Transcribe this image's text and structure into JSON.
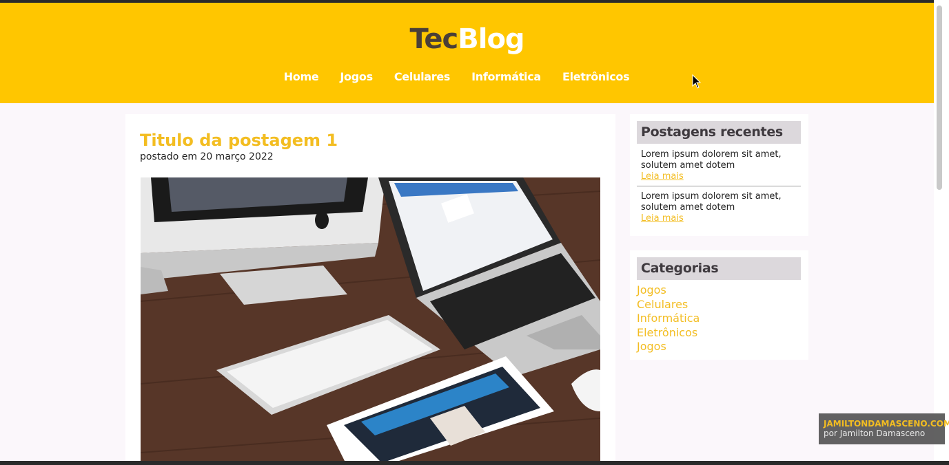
{
  "header": {
    "logo_part1": "Tec",
    "logo_part2": "Blog",
    "nav": [
      "Home",
      "Jogos",
      "Celulares",
      "Informática",
      "Eletrônicos"
    ]
  },
  "post": {
    "title": "Titulo da postagem 1",
    "date": "postado em 20 março 2022"
  },
  "sidebar": {
    "recent_title": "Postagens recentes",
    "recent": [
      {
        "text": "Lorem ipsum dolorem sit amet, solutem amet dotem",
        "more": "Leia mais"
      },
      {
        "text": "Lorem ipsum dolorem sit amet, solutem amet dotem",
        "more": "Leia mais"
      }
    ],
    "categories_title": "Categorias",
    "categories": [
      "Jogos",
      "Celulares",
      "Informática",
      "Eletrônicos",
      "Jogos"
    ]
  },
  "watermark": {
    "line1": "JAMILTONDAMASCENO.COM",
    "line2": "por Jamilton Damasceno"
  },
  "colors": {
    "header": "#ffc600",
    "accent": "#f3bd21",
    "page_bg": "#fbf7fb"
  }
}
